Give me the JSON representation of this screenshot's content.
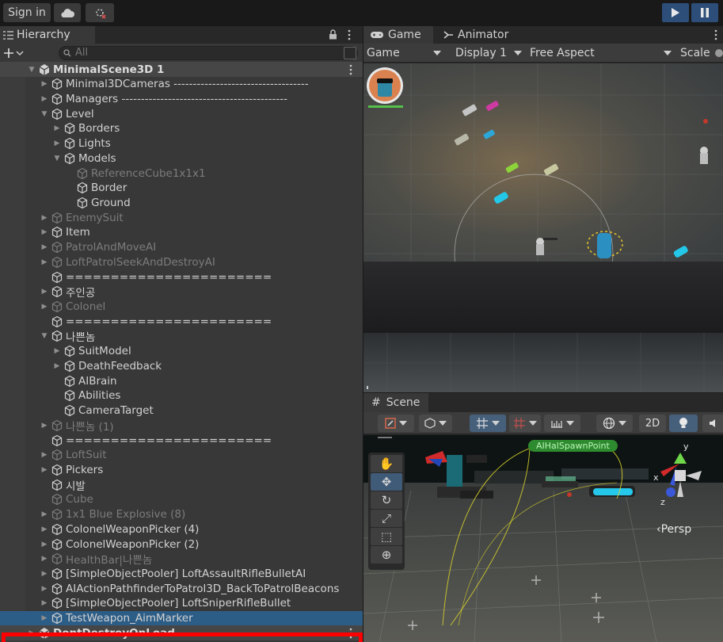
{
  "toolbar": {
    "signin_label": "Sign in",
    "cloud_icon": "cloud-icon",
    "collab_icon": "collab-icon"
  },
  "hierarchy": {
    "tab_label": "Hierarchy",
    "search_placeholder": "All",
    "rows": [
      {
        "label": "MinimalScene3D 1",
        "indent": 0,
        "arrow": "down",
        "kind": "scene",
        "dim": false,
        "menu": true
      },
      {
        "label": "Minimal3DCameras -----------------------------------",
        "indent": 1,
        "arrow": "right",
        "kind": "obj",
        "dim": false
      },
      {
        "label": "Managers -------------------------------------------",
        "indent": 1,
        "arrow": "right",
        "kind": "obj",
        "dim": false
      },
      {
        "label": "Level",
        "indent": 1,
        "arrow": "down",
        "kind": "obj",
        "dim": false
      },
      {
        "label": "Borders",
        "indent": 2,
        "arrow": "right",
        "kind": "obj",
        "dim": false
      },
      {
        "label": "Lights",
        "indent": 2,
        "arrow": "right",
        "kind": "obj",
        "dim": false
      },
      {
        "label": "Models",
        "indent": 2,
        "arrow": "down",
        "kind": "obj",
        "dim": false
      },
      {
        "label": "ReferenceCube1x1x1",
        "indent": 3,
        "arrow": "",
        "kind": "obj",
        "dim": true
      },
      {
        "label": "Border",
        "indent": 3,
        "arrow": "",
        "kind": "obj",
        "dim": false
      },
      {
        "label": "Ground",
        "indent": 3,
        "arrow": "",
        "kind": "obj",
        "dim": false
      },
      {
        "label": "EnemySuit",
        "indent": 1,
        "arrow": "right",
        "kind": "obj",
        "dim": true
      },
      {
        "label": "Item",
        "indent": 1,
        "arrow": "right",
        "kind": "obj",
        "dim": false
      },
      {
        "label": "PatrolAndMoveAI",
        "indent": 1,
        "arrow": "right",
        "kind": "obj",
        "dim": true
      },
      {
        "label": "LoftPatrolSeekAndDestroyAI",
        "indent": 1,
        "arrow": "right",
        "kind": "obj",
        "dim": true
      },
      {
        "label": "=======================",
        "indent": 1,
        "arrow": "",
        "kind": "obj",
        "dim": false
      },
      {
        "label": "주인공",
        "indent": 1,
        "arrow": "right",
        "kind": "obj",
        "dim": false
      },
      {
        "label": "Colonel",
        "indent": 1,
        "arrow": "right",
        "kind": "obj",
        "dim": true
      },
      {
        "label": "=======================",
        "indent": 1,
        "arrow": "",
        "kind": "obj",
        "dim": false
      },
      {
        "label": "나쁜놈",
        "indent": 1,
        "arrow": "down",
        "kind": "obj",
        "dim": false
      },
      {
        "label": "SuitModel",
        "indent": 2,
        "arrow": "right",
        "kind": "obj",
        "dim": false
      },
      {
        "label": "DeathFeedback",
        "indent": 2,
        "arrow": "right",
        "kind": "obj",
        "dim": false
      },
      {
        "label": "AIBrain",
        "indent": 2,
        "arrow": "",
        "kind": "obj",
        "dim": false
      },
      {
        "label": "Abilities",
        "indent": 2,
        "arrow": "",
        "kind": "obj",
        "dim": false
      },
      {
        "label": "CameraTarget",
        "indent": 2,
        "arrow": "",
        "kind": "obj",
        "dim": false
      },
      {
        "label": "나쁜놈 (1)",
        "indent": 1,
        "arrow": "right",
        "kind": "obj",
        "dim": true
      },
      {
        "label": "=======================",
        "indent": 1,
        "arrow": "",
        "kind": "obj",
        "dim": false
      },
      {
        "label": "LoftSuit",
        "indent": 1,
        "arrow": "right",
        "kind": "obj",
        "dim": true
      },
      {
        "label": "Pickers",
        "indent": 1,
        "arrow": "right",
        "kind": "obj",
        "dim": false
      },
      {
        "label": "시발",
        "indent": 1,
        "arrow": "",
        "kind": "obj",
        "dim": false
      },
      {
        "label": "Cube",
        "indent": 1,
        "arrow": "",
        "kind": "obj",
        "dim": true
      },
      {
        "label": "1x1 Blue Explosive (8)",
        "indent": 1,
        "arrow": "right",
        "kind": "obj",
        "dim": true
      },
      {
        "label": "ColonelWeaponPicker (4)",
        "indent": 1,
        "arrow": "right",
        "kind": "obj",
        "dim": false
      },
      {
        "label": "ColonelWeaponPicker (2)",
        "indent": 1,
        "arrow": "right",
        "kind": "obj",
        "dim": false
      },
      {
        "label": "HealthBar|나쁜놈",
        "indent": 1,
        "arrow": "right",
        "kind": "obj",
        "dim": true
      },
      {
        "label": "[SimpleObjectPooler] LoftAssaultRifleBulletAI",
        "indent": 1,
        "arrow": "right",
        "kind": "obj",
        "dim": false
      },
      {
        "label": "AIActionPathfinderToPatrol3D_BackToPatrolBeacons",
        "indent": 1,
        "arrow": "right",
        "kind": "obj",
        "dim": false
      },
      {
        "label": "[SimpleObjectPooler] LoftSniperRifleBullet",
        "indent": 1,
        "arrow": "right",
        "kind": "obj",
        "dim": false
      },
      {
        "label": "TestWeapon_AimMarker",
        "indent": 1,
        "arrow": "right",
        "kind": "obj",
        "dim": false,
        "selected": true
      },
      {
        "label": "DontDestroyOnLoad",
        "indent": 0,
        "arrow": "right",
        "kind": "scene",
        "dim": false,
        "menu": true
      }
    ]
  },
  "game": {
    "tab_game": "Game",
    "tab_animator": "Animator",
    "dropdown_game": "Game",
    "dropdown_display": "Display 1",
    "dropdown_aspect": "Free Aspect",
    "scale_label": "Scale"
  },
  "scene": {
    "tab_label": "Scene",
    "btn_2d": "2D",
    "persp_label": "Persp",
    "spawn_label": "AIHalSpawnPoint",
    "axis_x": "x",
    "axis_y": "y",
    "axis_z": "z"
  },
  "colors": {
    "selection": "#2c5d87",
    "highlight_box": "#ff0000",
    "play_button": "#2d4e79"
  }
}
